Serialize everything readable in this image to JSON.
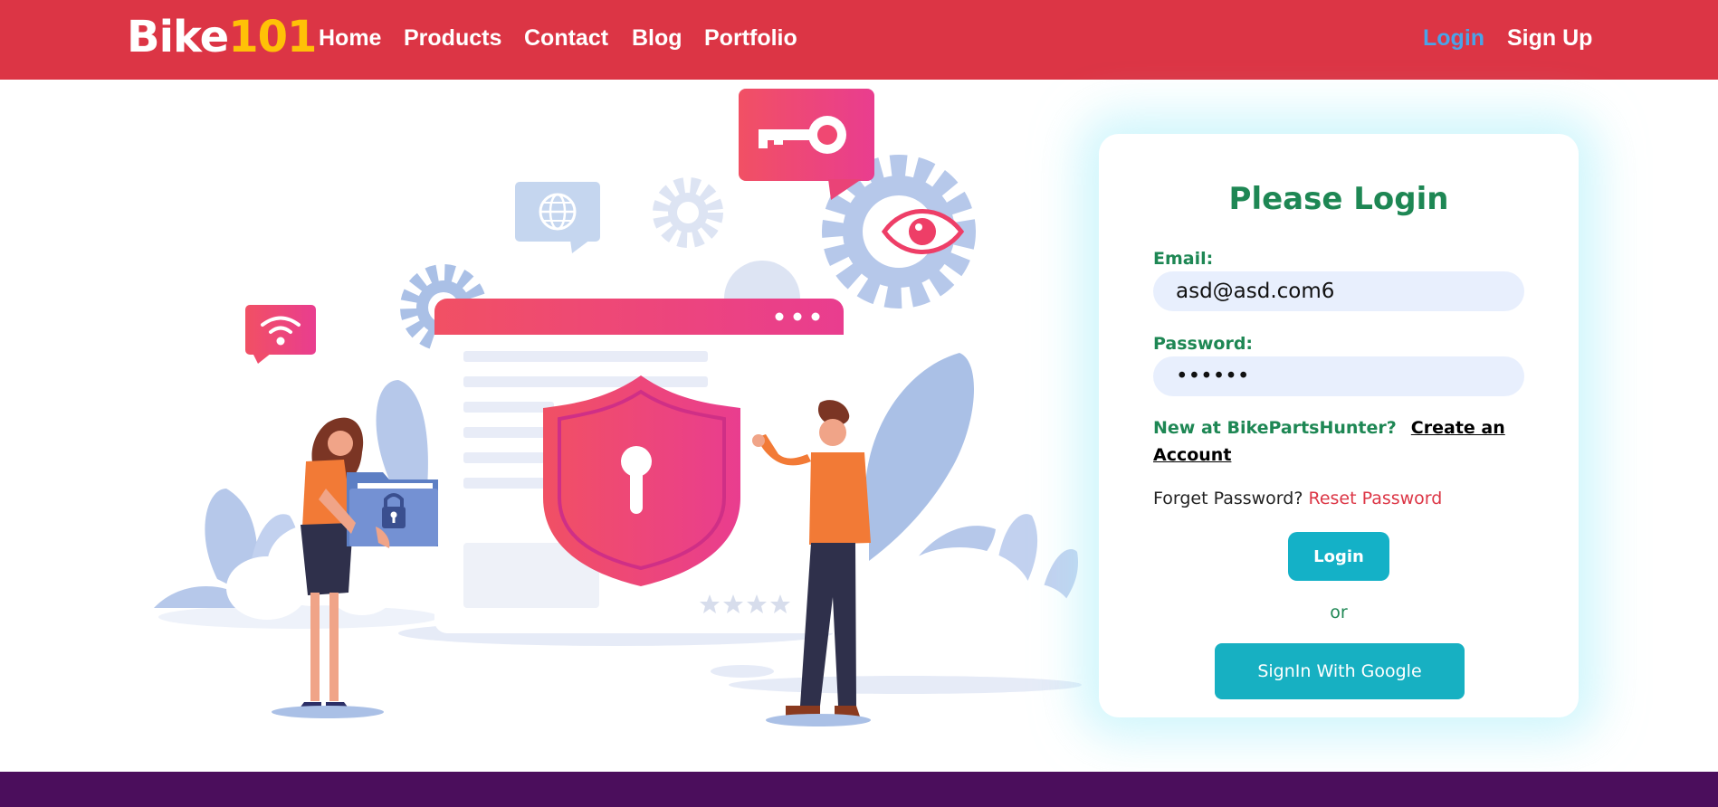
{
  "nav": {
    "brand_word": "Bike",
    "brand_number": "101",
    "links": [
      "Home",
      "Products",
      "Contact",
      "Blog",
      "Portfolio"
    ],
    "login": "Login",
    "signup": "Sign Up"
  },
  "login_card": {
    "title": "Please Login",
    "email_label": "Email:",
    "email_value": "asd@asd.com6",
    "password_label": "Password:",
    "password_value": "••••••",
    "new_at_text": "New at BikePartsHunter?",
    "create_account_link": "Create an Account",
    "forget_text": "Forget Password?",
    "reset_link": "Reset Password",
    "login_button": "Login",
    "or_text": "or",
    "google_button": "SignIn With Google"
  },
  "colors": {
    "navbar": "#dc3545",
    "brand_number": "#ffc107",
    "active_link": "#4aa3e8",
    "heading_green": "#1e8754",
    "button_teal": "#14b1c7",
    "footer": "#4b0e5c"
  },
  "illustration": {
    "icons": [
      "key-icon",
      "eye-icon",
      "globe-icon",
      "wifi-icon",
      "shield-lock-icon",
      "folder-lock-icon",
      "gear-icon",
      "star-icon"
    ]
  }
}
